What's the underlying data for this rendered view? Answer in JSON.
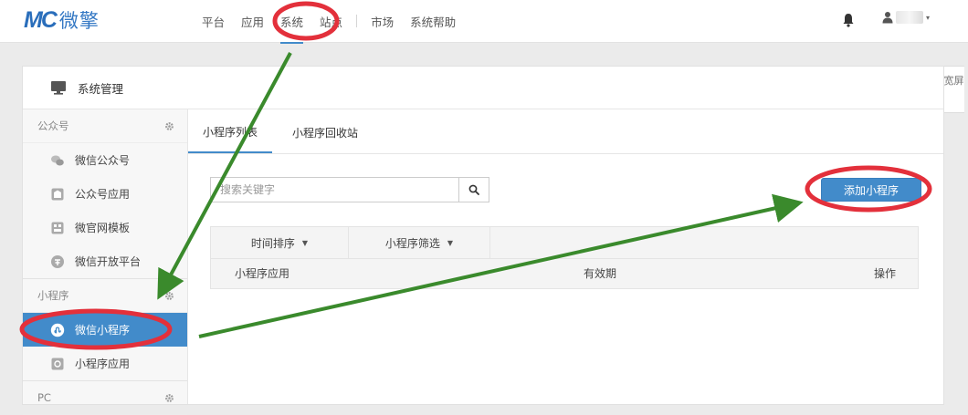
{
  "header": {
    "logo_mark": "MC",
    "logo_text": "微擎",
    "nav": [
      {
        "label": "平台"
      },
      {
        "label": "应用"
      },
      {
        "label": "系统"
      },
      {
        "label": "站点"
      },
      {
        "label": "市场"
      },
      {
        "label": "系统帮助"
      }
    ],
    "active_nav": "系统",
    "bell_icon": "bell-icon",
    "user_icon": "user-icon",
    "user_caret": "▾"
  },
  "side_tab": {
    "label": "宽屏"
  },
  "panel": {
    "title": "系统管理",
    "icon": "monitor-icon"
  },
  "sidebar": {
    "groups": [
      {
        "title": "公众号",
        "items": [
          {
            "label": "微信公众号",
            "icon": "wechat-icon"
          },
          {
            "label": "公众号应用",
            "icon": "app-icon"
          },
          {
            "label": "微官网模板",
            "icon": "template-icon"
          },
          {
            "label": "微信开放平台",
            "icon": "open-platform-icon"
          }
        ]
      },
      {
        "title": "小程序",
        "items": [
          {
            "label": "微信小程序",
            "icon": "miniprogram-icon",
            "active": true
          },
          {
            "label": "小程序应用",
            "icon": "miniprogram-app-icon"
          }
        ]
      },
      {
        "title": "PC",
        "items": []
      }
    ]
  },
  "content": {
    "tabs": [
      {
        "label": "小程序列表",
        "active": true
      },
      {
        "label": "小程序回收站"
      }
    ],
    "search": {
      "placeholder": "搜索关键字",
      "value": ""
    },
    "add_button": "添加小程序",
    "filters": [
      {
        "label": "时间排序"
      },
      {
        "label": "小程序筛选"
      }
    ],
    "columns": [
      "小程序应用",
      "有效期",
      "操作"
    ]
  },
  "colors": {
    "accent": "#428bca",
    "annotation_red": "#e3303b",
    "annotation_green": "#3a8a2c"
  }
}
